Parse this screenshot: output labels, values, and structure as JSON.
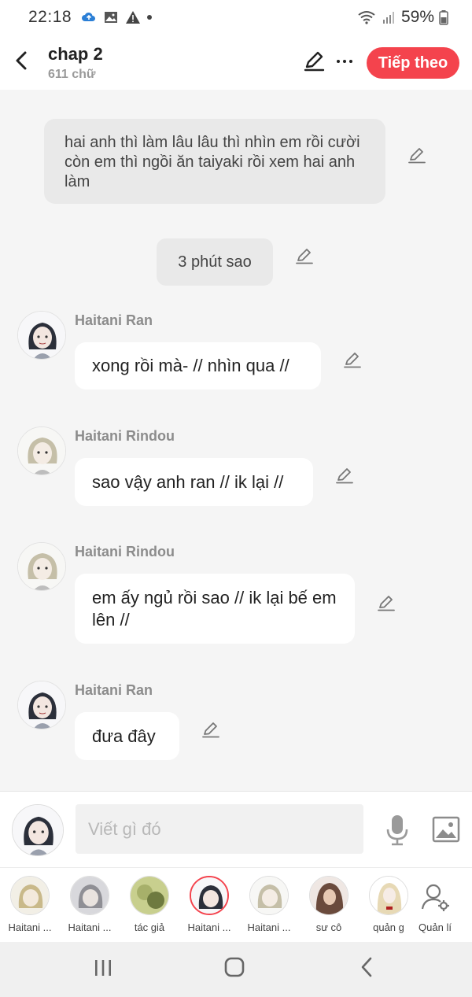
{
  "status_bar": {
    "time": "22:18",
    "battery": "59%"
  },
  "header": {
    "title": "chap 2",
    "subtitle": "611 chữ",
    "next_label": "Tiếp theo"
  },
  "chat": {
    "narration": "hai anh thì làm lâu lâu thì nhìn em rồi cười còn em thì ngồi ăn taiyaki rồi xem hai anh làm",
    "time_note": "3 phút sao",
    "messages": [
      {
        "speaker": "Haitani Ran",
        "text": "xong rồi mà- // nhìn qua //"
      },
      {
        "speaker": "Haitani Rindou",
        "text": "sao vậy anh ran // ik lại //"
      },
      {
        "speaker": "Haitani Rindou",
        "text": "em ấy ngủ rồi sao // ik lại bế em lên //"
      },
      {
        "speaker": "Haitani Ran",
        "text": "đưa đây"
      }
    ]
  },
  "input": {
    "placeholder": "Viết gì đó",
    "value": ""
  },
  "characters": [
    {
      "label": "Haitani ...",
      "color": "#c9b98a",
      "active": false
    },
    {
      "label": "Haitani ...",
      "color": "#8f8f95",
      "active": false
    },
    {
      "label": "tác giả",
      "color": "#a7b06a",
      "active": false
    },
    {
      "label": "Haitani ...",
      "color": "#2b2f3a",
      "active": true
    },
    {
      "label": "Haitani ...",
      "color": "#c5bfa8",
      "active": false
    },
    {
      "label": "sư cô",
      "color": "#6a4a3c",
      "active": false
    },
    {
      "label": "quản g",
      "color": "#e7d9b5",
      "active": false
    },
    {
      "label": "Quản lí",
      "color": "#ffffff",
      "active": false
    }
  ],
  "colors": {
    "accent": "#f4434d",
    "chat_bg": "#f5f5f5",
    "bubble": "#ffffff",
    "narration_bg": "#e9e9e9"
  }
}
